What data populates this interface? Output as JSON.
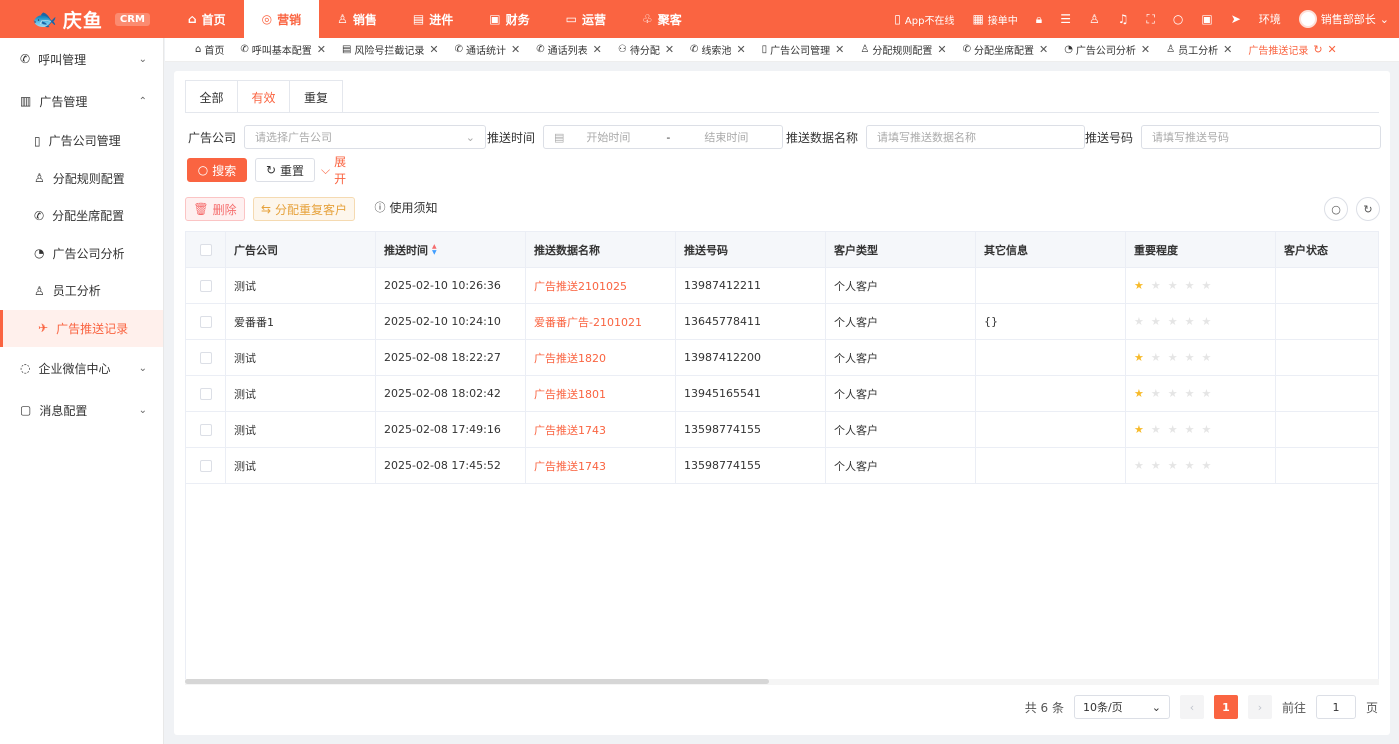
{
  "app": {
    "logo_text": "庆鱼",
    "badge": "CRM"
  },
  "nav": [
    {
      "label": "首页",
      "icon": "⌂",
      "icon_name": "home-icon"
    },
    {
      "label": "营销",
      "icon": "◎",
      "icon_name": "marketing-icon",
      "active": true
    },
    {
      "label": "销售",
      "icon": "♙",
      "icon_name": "sales-icon"
    },
    {
      "label": "进件",
      "icon": "▤",
      "icon_name": "document-icon"
    },
    {
      "label": "财务",
      "icon": "▣",
      "icon_name": "finance-icon"
    },
    {
      "label": "运营",
      "icon": "▭",
      "icon_name": "monitor-icon"
    },
    {
      "label": "聚客",
      "icon": "♧",
      "icon_name": "group-icon"
    }
  ],
  "top_right": {
    "app_status": "App不在线",
    "dispatch_status": "接单中",
    "env_label": "环境",
    "user_name": "销售部部长"
  },
  "sidebar": {
    "groups": [
      {
        "label": "呼叫管理",
        "icon": "✆",
        "icon_name": "phone-icon",
        "expanded": false
      },
      {
        "label": "广告管理",
        "icon": "▥",
        "icon_name": "ad-icon",
        "expanded": true,
        "items": [
          {
            "label": "广告公司管理",
            "icon": "▯",
            "icon_name": "building-icon"
          },
          {
            "label": "分配规则配置",
            "icon": "♙",
            "icon_name": "user-rule-icon"
          },
          {
            "label": "分配坐席配置",
            "icon": "✆",
            "icon_name": "seat-icon"
          },
          {
            "label": "广告公司分析",
            "icon": "◔",
            "icon_name": "pie-icon"
          },
          {
            "label": "员工分析",
            "icon": "♙",
            "icon_name": "staff-icon"
          },
          {
            "label": "广告推送记录",
            "icon": "✈",
            "icon_name": "push-icon",
            "active": true
          }
        ]
      },
      {
        "label": "企业微信中心",
        "icon": "◌",
        "icon_name": "wechat-icon",
        "expanded": false
      },
      {
        "label": "消息配置",
        "icon": "▢",
        "icon_name": "message-icon",
        "expanded": false
      }
    ]
  },
  "page_tabs": [
    {
      "label": "首页",
      "icon": "⌂",
      "closable": false
    },
    {
      "label": "呼叫基本配置",
      "icon": "✆",
      "closable": true
    },
    {
      "label": "风险号拦截记录",
      "icon": "▤",
      "closable": true
    },
    {
      "label": "通话统计",
      "icon": "✆",
      "closable": true
    },
    {
      "label": "通话列表",
      "icon": "✆",
      "closable": true
    },
    {
      "label": "待分配",
      "icon": "⚇",
      "closable": true
    },
    {
      "label": "线索池",
      "icon": "✆",
      "closable": true
    },
    {
      "label": "广告公司管理",
      "icon": "▯",
      "closable": true
    },
    {
      "label": "分配规则配置",
      "icon": "♙",
      "closable": true
    },
    {
      "label": "分配坐席配置",
      "icon": "✆",
      "closable": true
    },
    {
      "label": "广告公司分析",
      "icon": "◔",
      "closable": true
    },
    {
      "label": "员工分析",
      "icon": "♙",
      "closable": true
    },
    {
      "label": "广告推送记录",
      "icon": "",
      "closable": true,
      "active": true,
      "refresh": "↻"
    }
  ],
  "status_tabs": [
    {
      "label": "全部"
    },
    {
      "label": "有效",
      "active": true
    },
    {
      "label": "重复"
    }
  ],
  "filters": {
    "company_label": "广告公司",
    "company_placeholder": "请选择广告公司",
    "time_label": "推送时间",
    "time_start": "开始时间",
    "time_sep": "-",
    "time_end": "结束时间",
    "name_label": "推送数据名称",
    "name_placeholder": "请填写推送数据名称",
    "phone_label": "推送号码",
    "phone_placeholder": "请填写推送号码"
  },
  "actions": {
    "search": "搜索",
    "reset": "重置",
    "expand": "展开",
    "delete": "删除",
    "assign_dup": "分配重复客户",
    "usage_notice": "使用须知"
  },
  "table": {
    "columns": [
      "广告公司",
      "推送时间",
      "推送数据名称",
      "推送号码",
      "客户类型",
      "其它信息",
      "重要程度",
      "客户状态"
    ],
    "rows": [
      {
        "company": "测试",
        "time": "2025-02-10 10:26:36",
        "name": "广告推送2101025",
        "phone": "13987412211",
        "type": "个人客户",
        "other": "",
        "stars": 1,
        "status": ""
      },
      {
        "company": "爱番番1",
        "time": "2025-02-10 10:24:10",
        "name": "爱番番广告-2101021",
        "phone": "13645778411",
        "type": "个人客户",
        "other": "{}",
        "stars": 0,
        "status": ""
      },
      {
        "company": "测试",
        "time": "2025-02-08 18:22:27",
        "name": "广告推送1820",
        "phone": "13987412200",
        "type": "个人客户",
        "other": "",
        "stars": 1,
        "status": ""
      },
      {
        "company": "测试",
        "time": "2025-02-08 18:02:42",
        "name": "广告推送1801",
        "phone": "13945165541",
        "type": "个人客户",
        "other": "",
        "stars": 1,
        "status": ""
      },
      {
        "company": "测试",
        "time": "2025-02-08 17:49:16",
        "name": "广告推送1743",
        "phone": "13598774155",
        "type": "个人客户",
        "other": "",
        "stars": 1,
        "status": ""
      },
      {
        "company": "测试",
        "time": "2025-02-08 17:45:52",
        "name": "广告推送1743",
        "phone": "13598774155",
        "type": "个人客户",
        "other": "",
        "stars": 0,
        "status": ""
      }
    ],
    "max_stars": 5
  },
  "pagination": {
    "total_text": "共 6 条",
    "page_size": "10条/页",
    "prev": "‹",
    "current": "1",
    "next": "›",
    "goto_label": "前往",
    "goto_value": "1",
    "page_suffix": "页"
  },
  "colors": {
    "accent": "#fa6441",
    "star": "#f7ba2a"
  }
}
